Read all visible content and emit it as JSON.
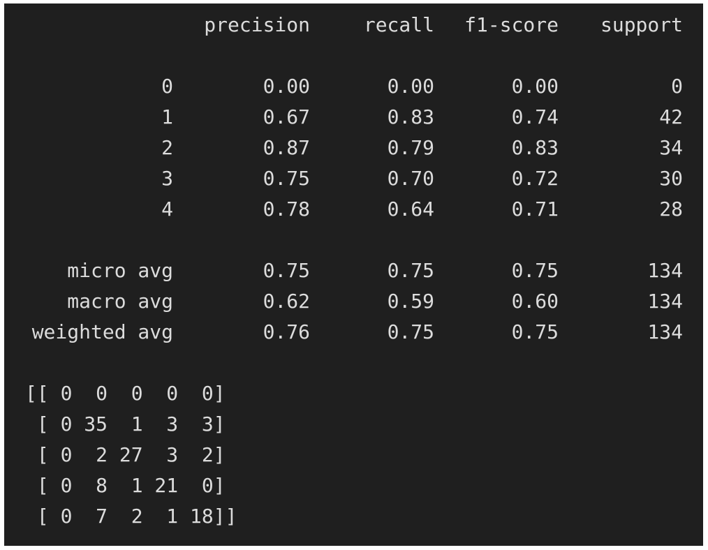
{
  "report": {
    "headers": [
      "precision",
      "recall",
      "f1-score",
      "support"
    ],
    "class_rows": [
      {
        "label": "0",
        "precision": "0.00",
        "recall": "0.00",
        "f1": "0.00",
        "support": "0"
      },
      {
        "label": "1",
        "precision": "0.67",
        "recall": "0.83",
        "f1": "0.74",
        "support": "42"
      },
      {
        "label": "2",
        "precision": "0.87",
        "recall": "0.79",
        "f1": "0.83",
        "support": "34"
      },
      {
        "label": "3",
        "precision": "0.75",
        "recall": "0.70",
        "f1": "0.72",
        "support": "30"
      },
      {
        "label": "4",
        "precision": "0.78",
        "recall": "0.64",
        "f1": "0.71",
        "support": "28"
      }
    ],
    "avg_rows": [
      {
        "label": "micro avg",
        "precision": "0.75",
        "recall": "0.75",
        "f1": "0.75",
        "support": "134"
      },
      {
        "label": "macro avg",
        "precision": "0.62",
        "recall": "0.59",
        "f1": "0.60",
        "support": "134"
      },
      {
        "label": "weighted avg",
        "precision": "0.76",
        "recall": "0.75",
        "f1": "0.75",
        "support": "134"
      }
    ]
  },
  "confusion_matrix": [
    "[[ 0  0  0  0  0]",
    " [ 0 35  1  3  3]",
    " [ 0  2 27  3  2]",
    " [ 0  8  1 21  0]",
    " [ 0  7  2  1 18]]"
  ],
  "theme": {
    "background": "#1f1f1f",
    "text": "#dcdcdc"
  }
}
